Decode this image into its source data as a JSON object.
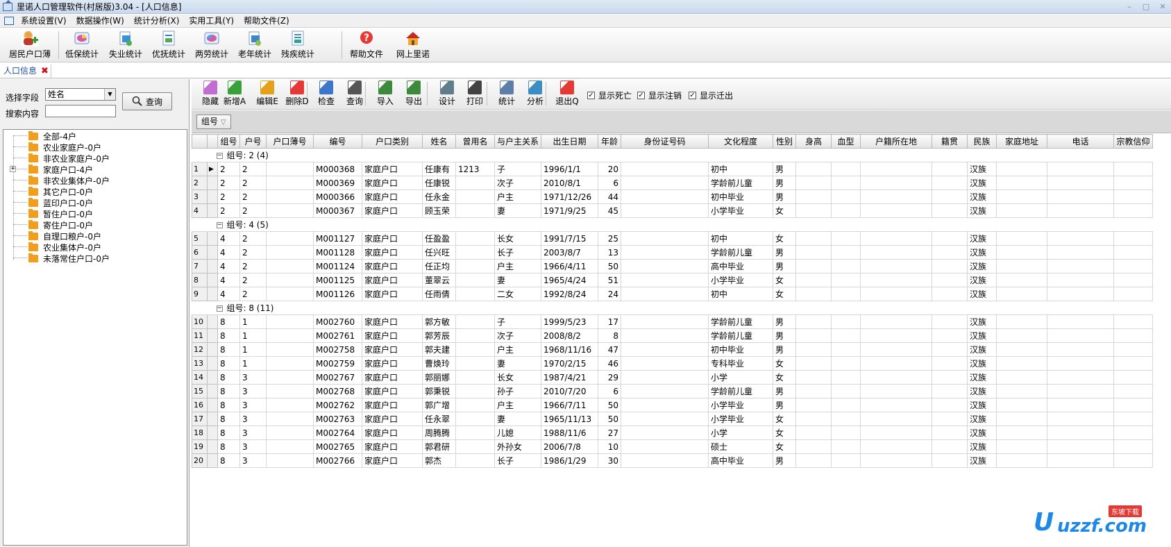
{
  "window": {
    "title": "里诺人口管理软件(村居版)3.04 - [人口信息]"
  },
  "menu": [
    "系统设置(V)",
    "数据操作(W)",
    "统计分析(X)",
    "实用工具(Y)",
    "帮助文件(Z)"
  ],
  "toolbar": [
    {
      "label": "居民户口薄",
      "icon": "resident-register-icon",
      "color": "#3a8f2a"
    },
    {
      "label": "低保统计",
      "icon": "subsistence-stats-icon",
      "color": "#3b6fc4"
    },
    {
      "label": "失业统计",
      "icon": "unemployment-stats-icon",
      "color": "#2e8bd1"
    },
    {
      "label": "优抚统计",
      "icon": "welfare-stats-icon",
      "color": "#2f7fc0"
    },
    {
      "label": "两劳统计",
      "icon": "two-labor-stats-icon",
      "color": "#3d6cc4"
    },
    {
      "label": "老年统计",
      "icon": "elderly-stats-icon",
      "color": "#3d86c9"
    },
    {
      "label": "残疾统计",
      "icon": "disability-stats-icon",
      "color": "#4a88c9"
    },
    {
      "label": "帮助文件",
      "icon": "help-icon",
      "color": "#d32f2f"
    },
    {
      "label": "网上里诺",
      "icon": "online-home-icon",
      "color": "#c62828"
    }
  ],
  "tab": {
    "label": "人口信息"
  },
  "search": {
    "field_label": "选择字段",
    "field_value": "姓名",
    "content_label": "搜索内容",
    "content_value": "",
    "button": "查询"
  },
  "tree": [
    "全部-4户",
    "农业家庭户-0户",
    "非农业家庭户-0户",
    "家庭户口-4户",
    "非农业集体户-0户",
    "其它户口-0户",
    "蓝印户口-0户",
    "暂住户口-0户",
    "寄住户口-0户",
    "自理口粮户-0户",
    "农业集体户-0户",
    "未落常住户口-0户"
  ],
  "toolbar2": [
    {
      "label": "隐藏",
      "icon": "hide-icon",
      "color": "#c06fd1"
    },
    {
      "label": "新增A",
      "icon": "add-icon",
      "color": "#3aa03a"
    },
    {
      "label": "编辑E",
      "icon": "edit-icon",
      "color": "#e3a21a"
    },
    {
      "label": "删除D",
      "icon": "delete-icon",
      "color": "#e53935"
    },
    {
      "label": "检查",
      "icon": "check-icon",
      "color": "#3c77c9"
    },
    {
      "label": "查询",
      "icon": "binoculars-icon",
      "color": "#555555"
    },
    {
      "label": "导入",
      "icon": "import-icon",
      "color": "#3d8a3d"
    },
    {
      "label": "导出",
      "icon": "export-icon",
      "color": "#3d8a3d"
    },
    {
      "label": "设计",
      "icon": "design-icon",
      "color": "#607d8b"
    },
    {
      "label": "打印",
      "icon": "print-icon",
      "color": "#424242"
    },
    {
      "label": "统计",
      "icon": "stats-icon",
      "color": "#5c7ea8"
    },
    {
      "label": "分析",
      "icon": "analysis-icon",
      "color": "#3c8dc4"
    },
    {
      "label": "退出Q",
      "icon": "exit-icon",
      "color": "#e53935"
    }
  ],
  "checkboxes": [
    {
      "label": "显示死亡",
      "checked": true
    },
    {
      "label": "显示注销",
      "checked": true
    },
    {
      "label": "显示迁出",
      "checked": true
    }
  ],
  "groupby": {
    "chip": "组号"
  },
  "columns": [
    "组号",
    "户号",
    "户口薄号",
    "编号",
    "户口类别",
    "姓名",
    "曾用名",
    "与户主关系",
    "出生日期",
    "年龄",
    "身份证号码",
    "文化程度",
    "性别",
    "身高",
    "血型",
    "户籍所在地",
    "籍贯",
    "民族",
    "家庭地址",
    "电话",
    "宗教信仰"
  ],
  "groups": [
    {
      "label": "组号: 2 (4)",
      "rows": [
        {
          "no": "1",
          "g": "2",
          "h": "2",
          "book": "",
          "id": "M000368",
          "type": "家庭户口",
          "name": "任康有",
          "alias": "1213",
          "rel": "子",
          "birth": "1996/1/1",
          "age": "20",
          "idcard": "",
          "edu": "初中",
          "sex": "男",
          "nation": "汉族"
        },
        {
          "no": "2",
          "g": "2",
          "h": "2",
          "book": "",
          "id": "M000369",
          "type": "家庭户口",
          "name": "任康锐",
          "alias": "",
          "rel": "次子",
          "birth": "2010/8/1",
          "age": "6",
          "idcard": "",
          "edu": "学龄前儿童",
          "sex": "男",
          "nation": "汉族"
        },
        {
          "no": "3",
          "g": "2",
          "h": "2",
          "book": "",
          "id": "M000366",
          "type": "家庭户口",
          "name": "任永金",
          "alias": "",
          "rel": "户主",
          "birth": "1971/12/26",
          "age": "44",
          "idcard": "",
          "edu": "初中毕业",
          "sex": "男",
          "nation": "汉族"
        },
        {
          "no": "4",
          "g": "2",
          "h": "2",
          "book": "",
          "id": "M000367",
          "type": "家庭户口",
          "name": "顾玉荣",
          "alias": "",
          "rel": "妻",
          "birth": "1971/9/25",
          "age": "45",
          "idcard": "",
          "edu": "小学毕业",
          "sex": "女",
          "nation": "汉族"
        }
      ]
    },
    {
      "label": "组号: 4 (5)",
      "rows": [
        {
          "no": "5",
          "g": "4",
          "h": "2",
          "book": "",
          "id": "M001127",
          "type": "家庭户口",
          "name": "任盈盈",
          "alias": "",
          "rel": "长女",
          "birth": "1991/7/15",
          "age": "25",
          "idcard": "",
          "edu": "初中",
          "sex": "女",
          "nation": "汉族"
        },
        {
          "no": "6",
          "g": "4",
          "h": "2",
          "book": "",
          "id": "M001128",
          "type": "家庭户口",
          "name": "任兴旺",
          "alias": "",
          "rel": "长子",
          "birth": "2003/8/7",
          "age": "13",
          "idcard": "",
          "edu": "学龄前儿童",
          "sex": "男",
          "nation": "汉族"
        },
        {
          "no": "7",
          "g": "4",
          "h": "2",
          "book": "",
          "id": "M001124",
          "type": "家庭户口",
          "name": "任正均",
          "alias": "",
          "rel": "户主",
          "birth": "1966/4/11",
          "age": "50",
          "idcard": "",
          "edu": "高中毕业",
          "sex": "男",
          "nation": "汉族"
        },
        {
          "no": "8",
          "g": "4",
          "h": "2",
          "book": "",
          "id": "M001125",
          "type": "家庭户口",
          "name": "董翠云",
          "alias": "",
          "rel": "妻",
          "birth": "1965/4/24",
          "age": "51",
          "idcard": "",
          "edu": "小学毕业",
          "sex": "女",
          "nation": "汉族"
        },
        {
          "no": "9",
          "g": "4",
          "h": "2",
          "book": "",
          "id": "M001126",
          "type": "家庭户口",
          "name": "任雨倩",
          "alias": "",
          "rel": "二女",
          "birth": "1992/8/24",
          "age": "24",
          "idcard": "",
          "edu": "初中",
          "sex": "女",
          "nation": "汉族"
        }
      ]
    },
    {
      "label": "组号: 8 (11)",
      "rows": [
        {
          "no": "10",
          "g": "8",
          "h": "1",
          "book": "",
          "id": "M002760",
          "type": "家庭户口",
          "name": "郭方敏",
          "alias": "",
          "rel": "子",
          "birth": "1999/5/23",
          "age": "17",
          "idcard": "",
          "edu": "学龄前儿童",
          "sex": "男",
          "nation": "汉族"
        },
        {
          "no": "11",
          "g": "8",
          "h": "1",
          "book": "",
          "id": "M002761",
          "type": "家庭户口",
          "name": "郭芳辰",
          "alias": "",
          "rel": "次子",
          "birth": "2008/8/2",
          "age": "8",
          "idcard": "",
          "edu": "学龄前儿童",
          "sex": "男",
          "nation": "汉族"
        },
        {
          "no": "12",
          "g": "8",
          "h": "1",
          "book": "",
          "id": "M002758",
          "type": "家庭户口",
          "name": "郭夫建",
          "alias": "",
          "rel": "户主",
          "birth": "1968/11/16",
          "age": "47",
          "idcard": "",
          "edu": "初中毕业",
          "sex": "男",
          "nation": "汉族"
        },
        {
          "no": "13",
          "g": "8",
          "h": "1",
          "book": "",
          "id": "M002759",
          "type": "家庭户口",
          "name": "曹焕玲",
          "alias": "",
          "rel": "妻",
          "birth": "1970/2/15",
          "age": "46",
          "idcard": "",
          "edu": "专科毕业",
          "sex": "女",
          "nation": "汉族"
        },
        {
          "no": "14",
          "g": "8",
          "h": "3",
          "book": "",
          "id": "M002767",
          "type": "家庭户口",
          "name": "郭丽娜",
          "alias": "",
          "rel": "长女",
          "birth": "1987/4/21",
          "age": "29",
          "idcard": "",
          "edu": "小学",
          "sex": "女",
          "nation": "汉族"
        },
        {
          "no": "15",
          "g": "8",
          "h": "3",
          "book": "",
          "id": "M002768",
          "type": "家庭户口",
          "name": "郭秉锐",
          "alias": "",
          "rel": "孙子",
          "birth": "2010/7/20",
          "age": "6",
          "idcard": "",
          "edu": "学龄前儿童",
          "sex": "男",
          "nation": "汉族"
        },
        {
          "no": "16",
          "g": "8",
          "h": "3",
          "book": "",
          "id": "M002762",
          "type": "家庭户口",
          "name": "郭广增",
          "alias": "",
          "rel": "户主",
          "birth": "1966/7/11",
          "age": "50",
          "idcard": "",
          "edu": "小学毕业",
          "sex": "男",
          "nation": "汉族"
        },
        {
          "no": "17",
          "g": "8",
          "h": "3",
          "book": "",
          "id": "M002763",
          "type": "家庭户口",
          "name": "任永翠",
          "alias": "",
          "rel": "妻",
          "birth": "1965/11/13",
          "age": "50",
          "idcard": "",
          "edu": "小学毕业",
          "sex": "女",
          "nation": "汉族"
        },
        {
          "no": "18",
          "g": "8",
          "h": "3",
          "book": "",
          "id": "M002764",
          "type": "家庭户口",
          "name": "周腾腾",
          "alias": "",
          "rel": "儿媳",
          "birth": "1988/11/6",
          "age": "27",
          "idcard": "",
          "edu": "小学",
          "sex": "女",
          "nation": "汉族"
        },
        {
          "no": "19",
          "g": "8",
          "h": "3",
          "book": "",
          "id": "M002765",
          "type": "家庭户口",
          "name": "郭君研",
          "alias": "",
          "rel": "外孙女",
          "birth": "2006/7/8",
          "age": "10",
          "idcard": "",
          "edu": "硕士",
          "sex": "女",
          "nation": "汉族"
        },
        {
          "no": "20",
          "g": "8",
          "h": "3",
          "book": "",
          "id": "M002766",
          "type": "家庭户口",
          "name": "郭杰",
          "alias": "",
          "rel": "长子",
          "birth": "1986/1/29",
          "age": "30",
          "idcard": "",
          "edu": "高中毕业",
          "sex": "男",
          "nation": "汉族"
        }
      ]
    }
  ],
  "watermark": {
    "text": "uzzf.com",
    "badge": "东坡下载"
  }
}
